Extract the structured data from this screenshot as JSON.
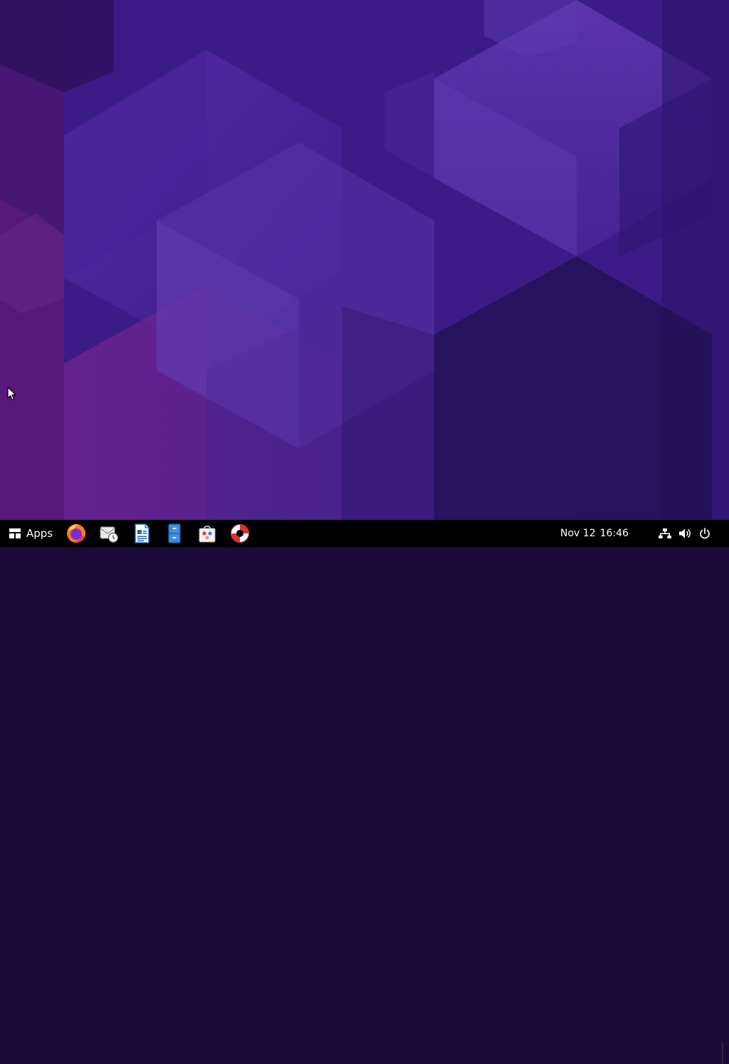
{
  "desktop": {
    "wallpaper": "purple-hexagon-wallpaper",
    "colors": {
      "primary": "#3a1e8a",
      "accent": "#5a2d9c",
      "dark": "#24115a"
    }
  },
  "taskbar": {
    "apps_label": "Apps",
    "launchers": [
      {
        "name": "firefox",
        "icon": "firefox-icon"
      },
      {
        "name": "evolution",
        "icon": "mail-clock-icon"
      },
      {
        "name": "writer",
        "icon": "document-writer-icon"
      },
      {
        "name": "files",
        "icon": "file-cabinet-icon"
      },
      {
        "name": "software",
        "icon": "software-bag-icon"
      },
      {
        "name": "help",
        "icon": "lifebuoy-icon"
      }
    ],
    "clock": {
      "date": "Nov 12",
      "time": "16:46"
    },
    "tray": {
      "network_icon": "network-icon",
      "volume_icon": "volume-icon",
      "power_icon": "power-icon"
    },
    "background": "#000000",
    "text_color": "#ffffff"
  }
}
